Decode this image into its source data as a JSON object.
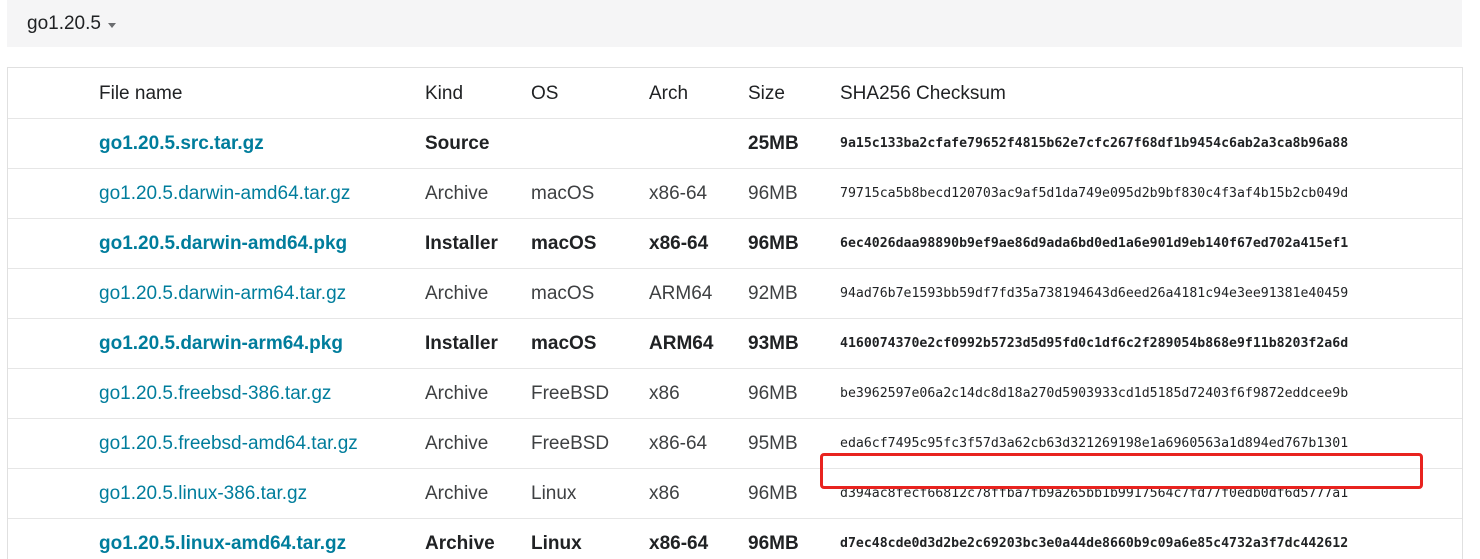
{
  "version_selector": {
    "label": "go1.20.5"
  },
  "table": {
    "headers": {
      "file_name": "File name",
      "kind": "Kind",
      "os": "OS",
      "arch": "Arch",
      "size": "Size",
      "checksum": "SHA256 Checksum"
    },
    "rows": [
      {
        "file": "go1.20.5.src.tar.gz",
        "kind": "Source",
        "os": "",
        "arch": "",
        "size": "25MB",
        "checksum": "9a15c133ba2cfafe79652f4815b62e7cfc267f68df1b9454c6ab2a3ca8b96a88",
        "featured": true
      },
      {
        "file": "go1.20.5.darwin-amd64.tar.gz",
        "kind": "Archive",
        "os": "macOS",
        "arch": "x86-64",
        "size": "96MB",
        "checksum": "79715ca5b8becd120703ac9af5d1da749e095d2b9bf830c4f3af4b15b2cb049d",
        "featured": false
      },
      {
        "file": "go1.20.5.darwin-amd64.pkg",
        "kind": "Installer",
        "os": "macOS",
        "arch": "x86-64",
        "size": "96MB",
        "checksum": "6ec4026daa98890b9ef9ae86d9ada6bd0ed1a6e901d9eb140f67ed702a415ef1",
        "featured": true
      },
      {
        "file": "go1.20.5.darwin-arm64.tar.gz",
        "kind": "Archive",
        "os": "macOS",
        "arch": "ARM64",
        "size": "92MB",
        "checksum": "94ad76b7e1593bb59df7fd35a738194643d6eed26a4181c94e3ee91381e40459",
        "featured": false
      },
      {
        "file": "go1.20.5.darwin-arm64.pkg",
        "kind": "Installer",
        "os": "macOS",
        "arch": "ARM64",
        "size": "93MB",
        "checksum": "4160074370e2cf0992b5723d5d95fd0c1df6c2f289054b868e9f11b8203f2a6d",
        "featured": true
      },
      {
        "file": "go1.20.5.freebsd-386.tar.gz",
        "kind": "Archive",
        "os": "FreeBSD",
        "arch": "x86",
        "size": "96MB",
        "checksum": "be3962597e06a2c14dc8d18a270d5903933cd1d5185d72403f6f9872eddcee9b",
        "featured": false
      },
      {
        "file": "go1.20.5.freebsd-amd64.tar.gz",
        "kind": "Archive",
        "os": "FreeBSD",
        "arch": "x86-64",
        "size": "95MB",
        "checksum": "eda6cf7495c95fc3f57d3a62cb63d321269198e1a6960563a1d894ed767b1301",
        "featured": false
      },
      {
        "file": "go1.20.5.linux-386.tar.gz",
        "kind": "Archive",
        "os": "Linux",
        "arch": "x86",
        "size": "96MB",
        "checksum": "d394ac8fecf66812c78ffba7fb9a265bb1b9917564c7fd77f0edb0df6d5777a1",
        "featured": false
      },
      {
        "file": "go1.20.5.linux-amd64.tar.gz",
        "kind": "Archive",
        "os": "Linux",
        "arch": "x86-64",
        "size": "96MB",
        "checksum": "d7ec48cde0d3d2be2c69203bc3e0a44de8660b9c09a6e85c4732a3f7dc442612",
        "featured": true
      }
    ]
  },
  "colors": {
    "link": "#007d9c",
    "highlight": "#e8231f",
    "version_bar_bg": "#f5f5f6"
  },
  "icons": {
    "version_caret": "caret-down-icon"
  }
}
